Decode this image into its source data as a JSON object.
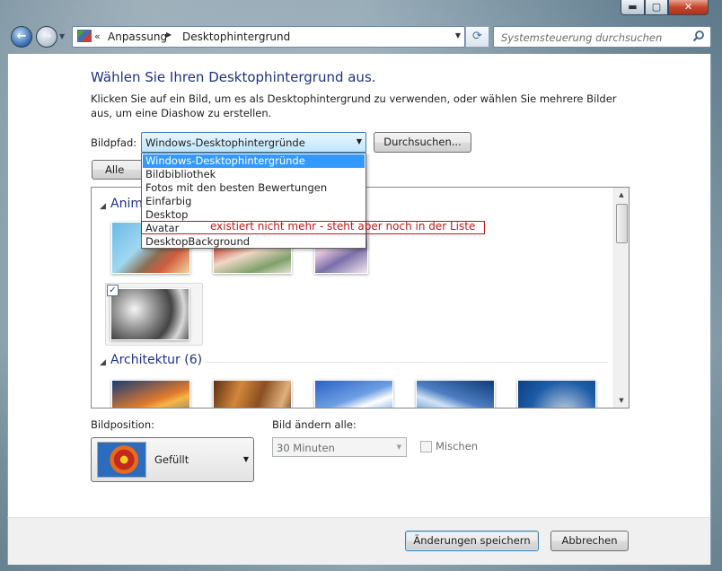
{
  "window": {
    "min_glyph": "▬",
    "max_glyph": "▢",
    "close_glyph": "✕"
  },
  "nav": {
    "back_glyph": "←",
    "forward_glyph": "→",
    "history_glyph": "▼"
  },
  "address": {
    "overflow": "«",
    "crumbs": [
      "Anpassung",
      "Desktophintergrund"
    ],
    "separator": "▶",
    "dropdown_glyph": "▼",
    "refresh_glyph": "⟳"
  },
  "search": {
    "placeholder": "Systemsteuerung durchsuchen"
  },
  "main": {
    "title": "Wählen Sie Ihren Desktophintergrund aus.",
    "description": "Klicken Sie auf ein Bild, um es als Desktophintergrund zu verwenden, oder wählen Sie mehrere Bilder aus, um eine Diashow zu erstellen.",
    "bildpfad_label": "Bildpfad:",
    "bildpfad_value": "Windows-Desktophintergründe",
    "browse_label": "Durchsuchen...",
    "select_all_label": "Alle auswählen"
  },
  "dropdown": {
    "items": [
      "Windows-Desktophintergründe",
      "Bildbibliothek",
      "Fotos mit den besten Bewertungen",
      "Einfarbig",
      "Desktop",
      "Avatar",
      "DesktopBackground"
    ],
    "selected": "Windows-Desktophintergründe"
  },
  "annotation": {
    "text": "existiert nicht mehr - steht aber noch in der Liste",
    "color": "#c81414"
  },
  "gallery": {
    "groups": [
      {
        "title": "Animationen",
        "visible_title": "Anim"
      },
      {
        "title": "Architektur (6)"
      }
    ],
    "checked_glyph": "✓"
  },
  "position": {
    "label": "Bildposition:",
    "value": "Gefüllt"
  },
  "slideshow": {
    "label": "Bild ändern alle:",
    "interval": "30 Minuten",
    "shuffle_label": "Mischen",
    "shuffle_checked": false
  },
  "footer": {
    "save_label": "Änderungen speichern",
    "cancel_label": "Abbrechen"
  },
  "colors": {
    "heading": "#1e3287",
    "selection": "#3399ff",
    "annotation": "#c81414"
  }
}
